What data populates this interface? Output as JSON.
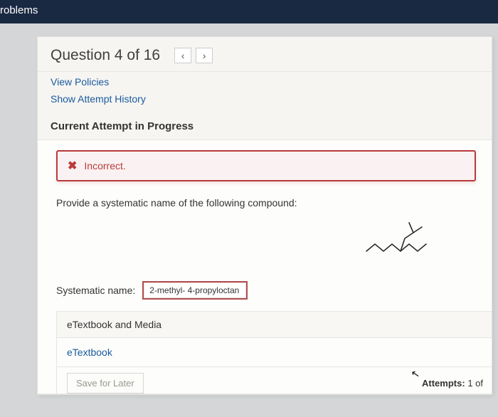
{
  "topbar": {
    "title": "roblems"
  },
  "question": {
    "header": "Question 4 of 16",
    "view_policies": "View Policies",
    "show_history": "Show Attempt History",
    "section": "Current Attempt in Progress",
    "feedback": "Incorrect.",
    "prompt": "Provide a systematic name of the following compound:",
    "answer_label": "Systematic name:",
    "answer_value": "2-methyl- 4-propyloctan"
  },
  "etextbook": {
    "header": "eTextbook and Media",
    "link": "eTextbook"
  },
  "footer": {
    "save": "Save for Later",
    "attempts_label": "Attempts:",
    "attempts_value": "1 of"
  }
}
